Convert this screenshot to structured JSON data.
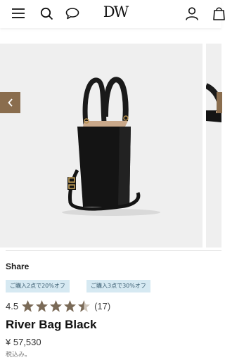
{
  "header": {
    "logo_text": "DW",
    "icons": [
      "menu-icon",
      "search-icon",
      "chat-icon",
      "account-icon",
      "cart-icon"
    ]
  },
  "gallery": {
    "prev_icon": "chevron-left-icon",
    "image_alt": "River Bag Black"
  },
  "share_label": "Share",
  "promos": [
    "ご購入2点で20%オフ",
    "ご購入3点で30%オフ"
  ],
  "rating": {
    "value": "4.5",
    "stars": 4.5,
    "count": "(17)"
  },
  "product": {
    "name": "River Bag Black",
    "price": "¥ 57,530",
    "tax_note": "税込み。"
  },
  "colors": {
    "accent": "#8a6d4e",
    "promo_bg": "#d6e9f2",
    "star": "#7a6a57"
  }
}
